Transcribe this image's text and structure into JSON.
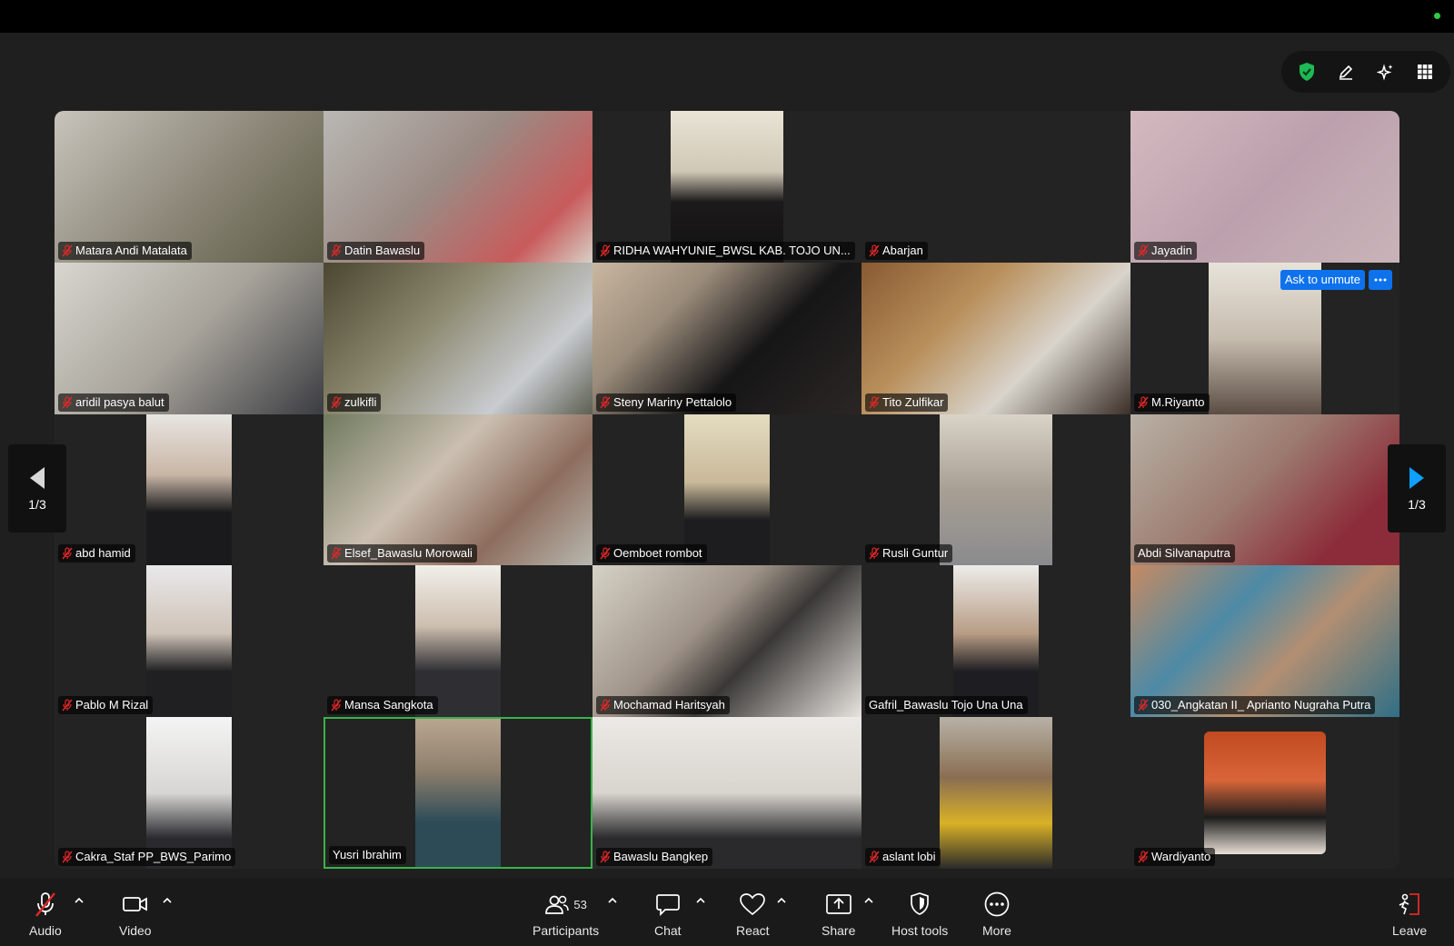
{
  "colors": {
    "active_speaker_border": "#38b44a",
    "accent": "#0e72ed",
    "muted_mic": "#e02828",
    "tile_bg": "#232323"
  },
  "top_tools": {
    "icons": [
      "shield-check-icon",
      "pencil-icon",
      "sparkle-icon",
      "grid-view-icon"
    ]
  },
  "pager": {
    "left_label": "1/3",
    "right_label": "1/3"
  },
  "participants": [
    {
      "name": "Matara Andi Matalata",
      "muted": true
    },
    {
      "name": "Datin Bawaslu",
      "muted": true
    },
    {
      "name": "RIDHA WAHYUNIE_BWSL KAB. TOJO UN...",
      "muted": true
    },
    {
      "name": "Abarjan",
      "muted": true
    },
    {
      "name": "Jayadin",
      "muted": true
    },
    {
      "name": "aridil pasya balut",
      "muted": true
    },
    {
      "name": "zulkifli",
      "muted": true
    },
    {
      "name": "Steny Mariny Pettalolo",
      "muted": true
    },
    {
      "name": "Tito Zulfikar",
      "muted": true
    },
    {
      "name": "M.Riyanto",
      "muted": true,
      "ask_to_unmute": "Ask to unmute"
    },
    {
      "name": "abd hamid",
      "muted": true
    },
    {
      "name": "Elsef_Bawaslu Morowali",
      "muted": true
    },
    {
      "name": "Oemboet rombot",
      "muted": true
    },
    {
      "name": "Rusli Guntur",
      "muted": true
    },
    {
      "name": "Abdi Silvanaputra",
      "muted": false
    },
    {
      "name": "Pablo M Rizal",
      "muted": true
    },
    {
      "name": "Mansa Sangkota",
      "muted": true
    },
    {
      "name": "Mochamad Haritsyah",
      "muted": true
    },
    {
      "name": "Gafril_Bawaslu Tojo Una Una",
      "muted": false
    },
    {
      "name": "030_Angkatan II_ Aprianto Nugraha Putra",
      "muted": true
    },
    {
      "name": "Cakra_Staf PP_BWS_Parimo",
      "muted": true
    },
    {
      "name": "Yusri Ibrahim",
      "muted": false,
      "active": true
    },
    {
      "name": "Bawaslu Bangkep",
      "muted": true
    },
    {
      "name": "aslant lobi",
      "muted": true
    },
    {
      "name": "Wardiyanto",
      "muted": true
    }
  ],
  "toolbar": {
    "audio": "Audio",
    "video": "Video",
    "participants": "Participants",
    "participants_count": "53",
    "chat": "Chat",
    "react": "React",
    "share": "Share",
    "host_tools": "Host tools",
    "more": "More",
    "leave": "Leave"
  }
}
